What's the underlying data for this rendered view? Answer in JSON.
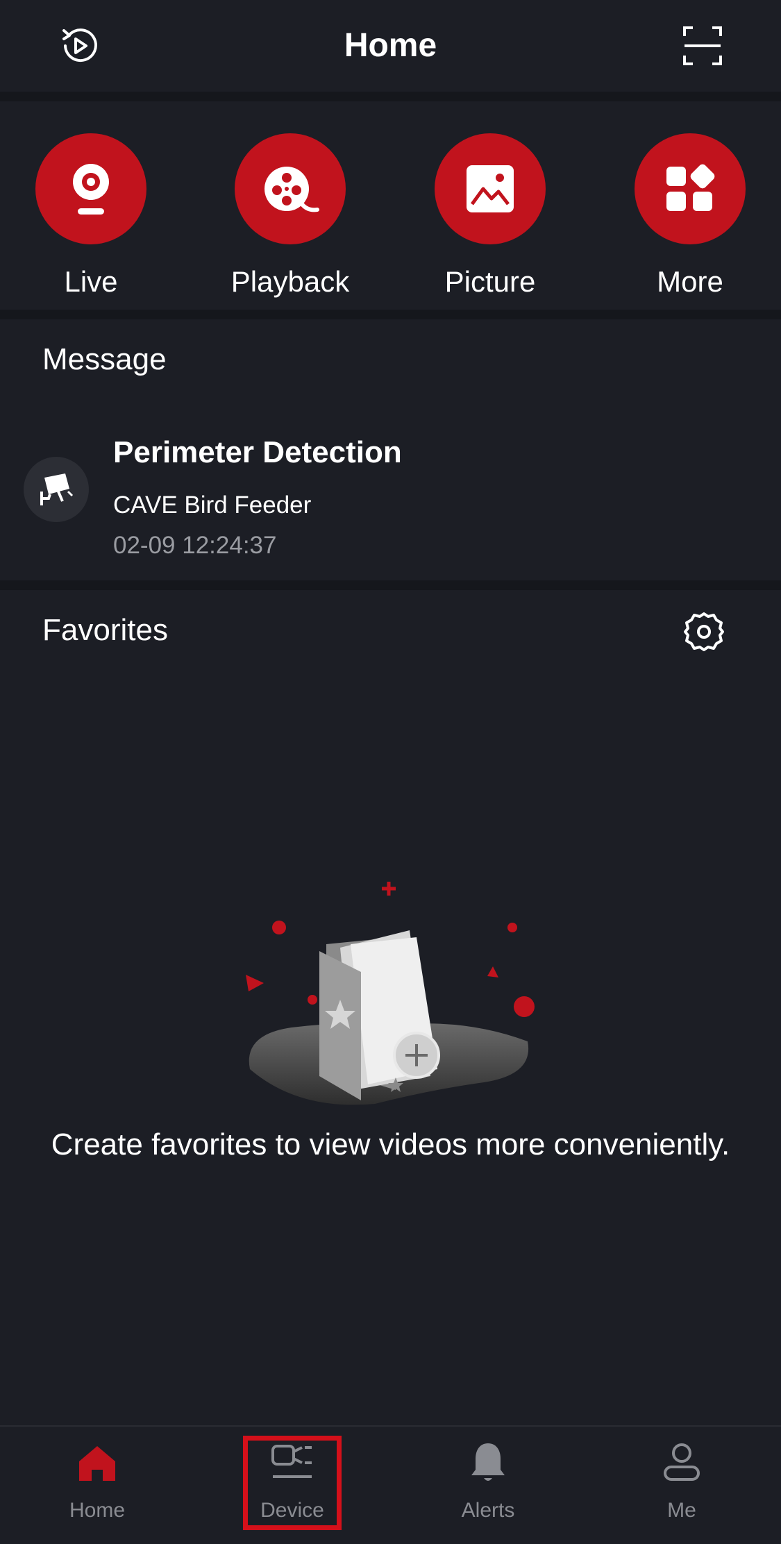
{
  "header": {
    "title": "Home",
    "history_icon": "history-play-icon",
    "scan_icon": "scan-icon"
  },
  "quick": {
    "items": [
      {
        "label": "Live",
        "icon": "camera-icon"
      },
      {
        "label": "Playback",
        "icon": "film-reel-icon"
      },
      {
        "label": "Picture",
        "icon": "picture-icon"
      },
      {
        "label": "More",
        "icon": "grid-icon"
      }
    ],
    "accent": "#c1131d"
  },
  "message": {
    "title": "Message",
    "item": {
      "title": "Perimeter Detection",
      "device": "CAVE Bird Feeder",
      "time": "02-09 12:24:37",
      "icon": "security-camera-icon"
    }
  },
  "favorites": {
    "title": "Favorites",
    "empty_text": "Create favorites to view videos more conveniently.",
    "settings_icon": "gear-icon"
  },
  "tabs": [
    {
      "label": "Home",
      "icon": "home-icon",
      "active": true
    },
    {
      "label": "Device",
      "icon": "device-icon",
      "active": false
    },
    {
      "label": "Alerts",
      "icon": "bell-icon",
      "active": false
    },
    {
      "label": "Me",
      "icon": "person-icon",
      "active": false
    }
  ]
}
